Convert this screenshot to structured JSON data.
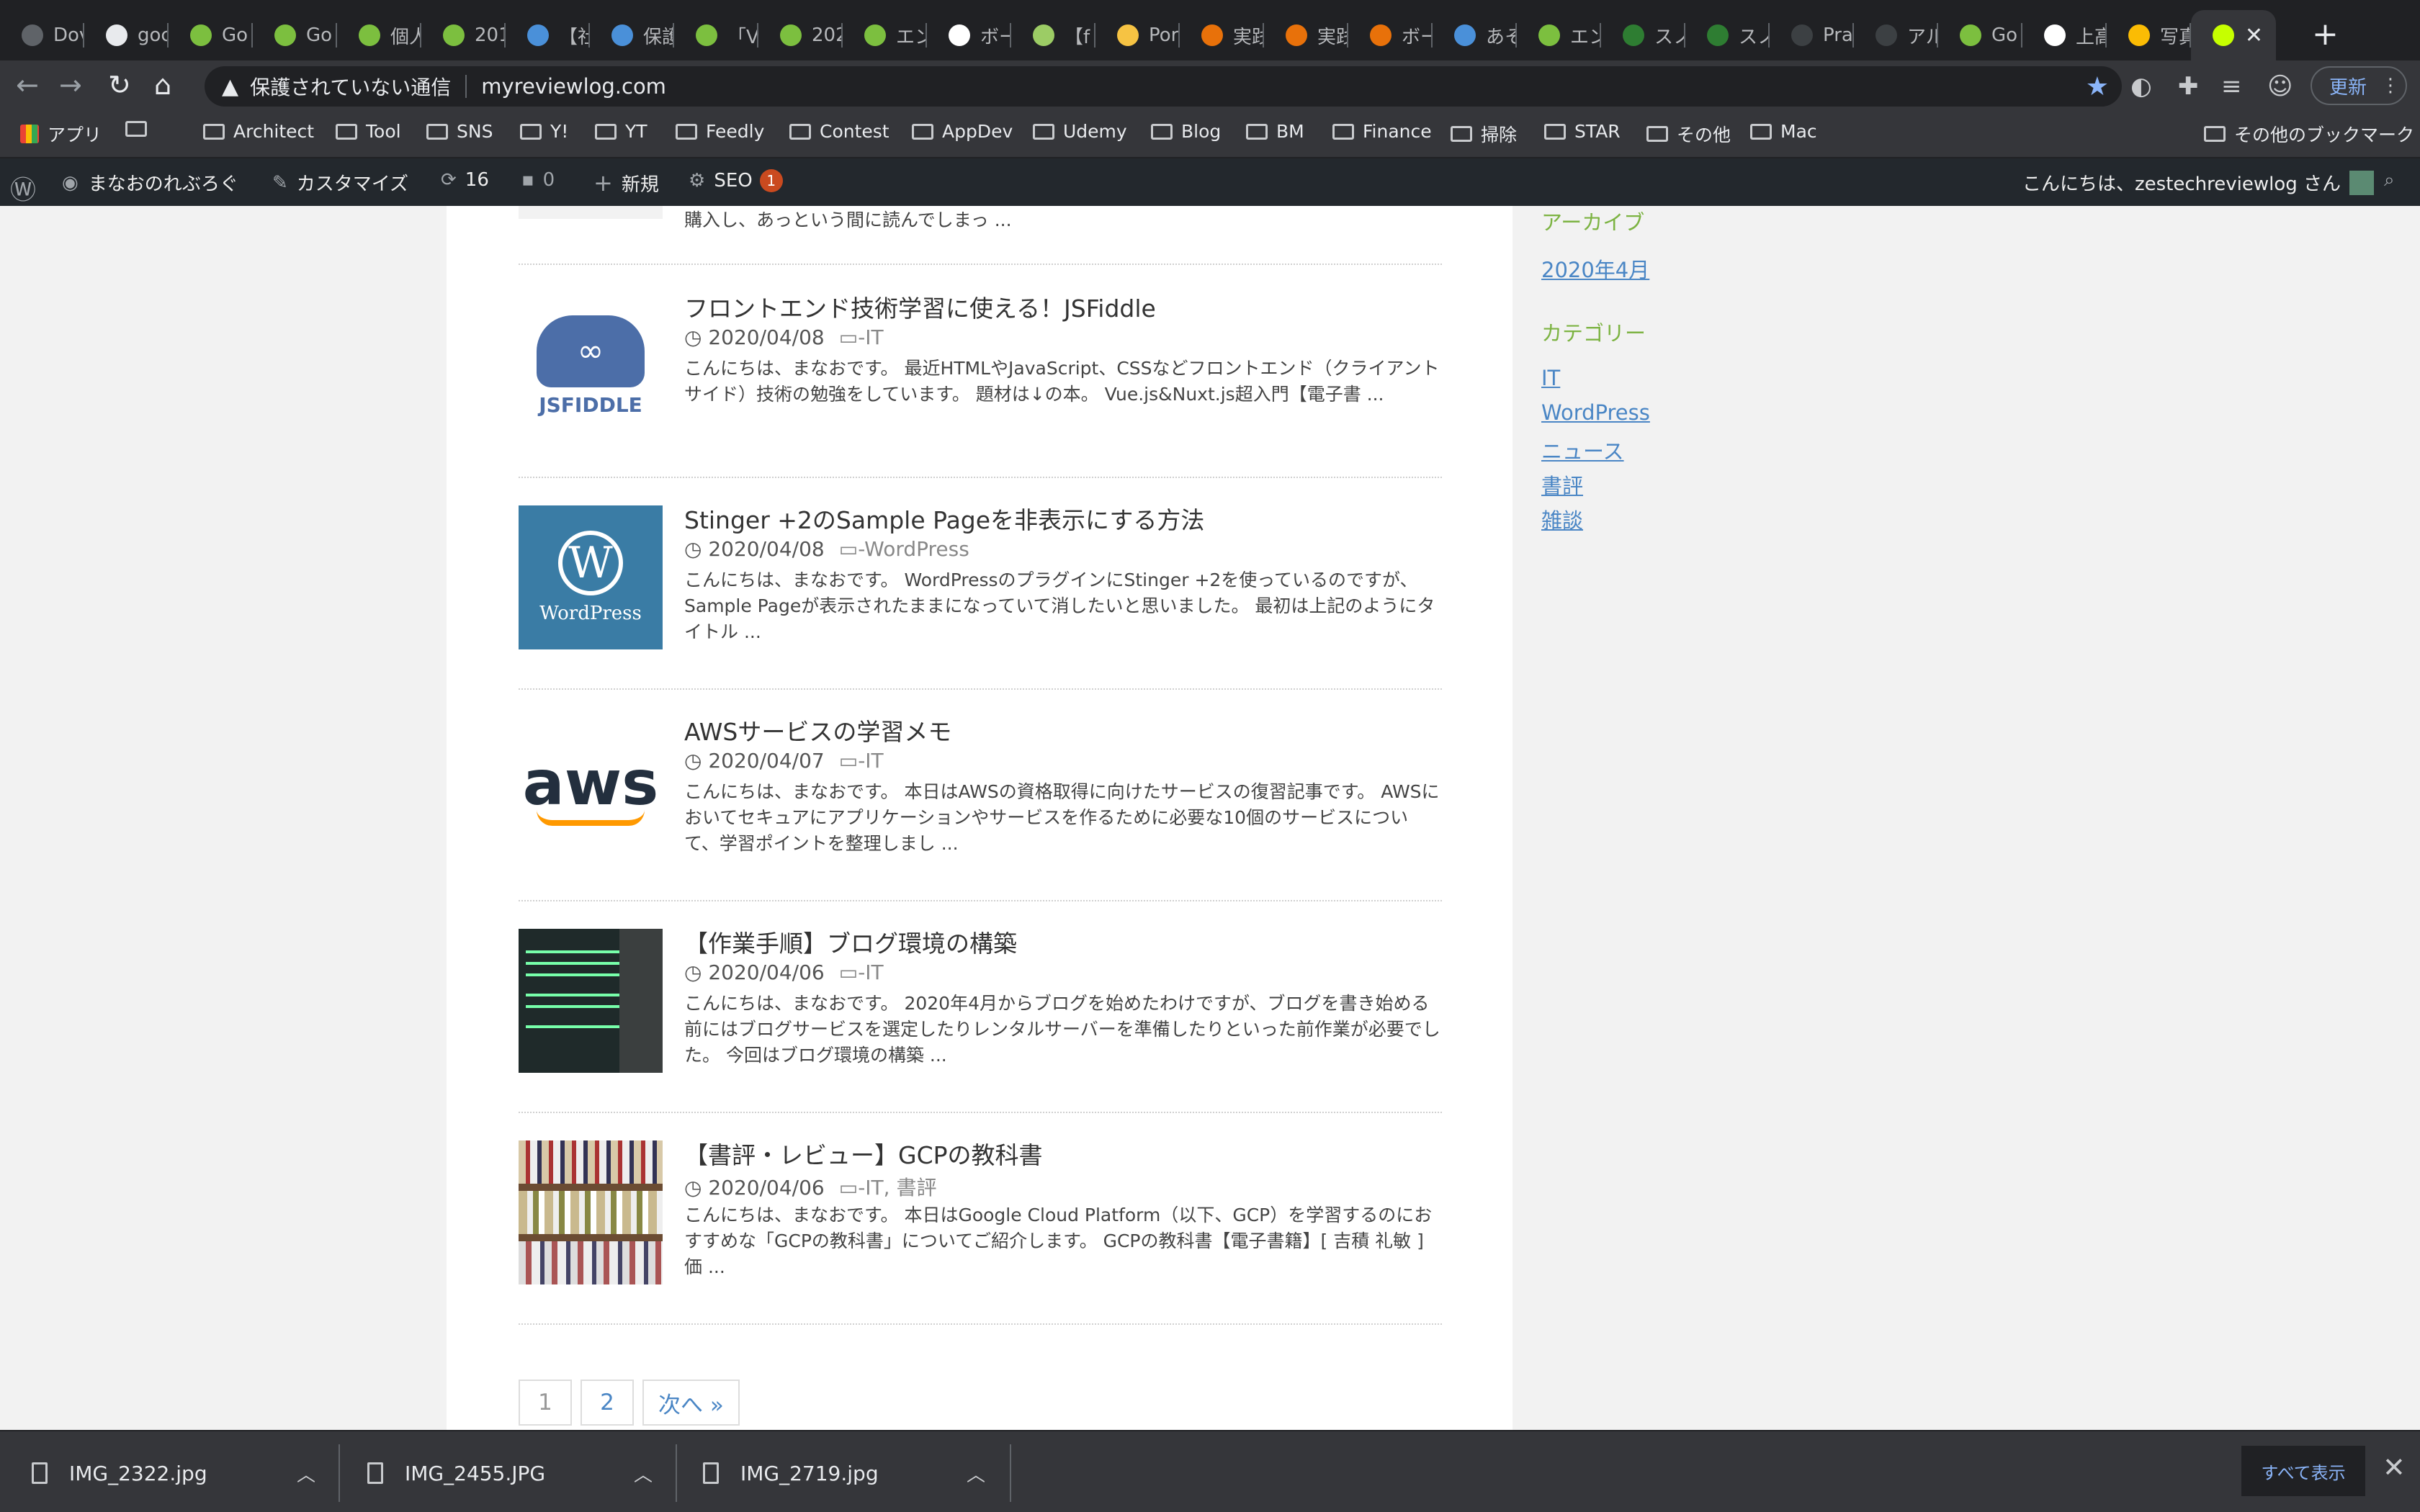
{
  "tabs": [
    {
      "label": "Dov",
      "color": "#5f6368"
    },
    {
      "label": "goc",
      "color": "#e8eaed"
    },
    {
      "label": "Go",
      "color": "#7cbf3f"
    },
    {
      "label": "Go",
      "color": "#7cbf3f"
    },
    {
      "label": "個人",
      "color": "#7cbf3f"
    },
    {
      "label": "201",
      "color": "#7cbf3f"
    },
    {
      "label": "【社",
      "color": "#4a90d9"
    },
    {
      "label": "保護",
      "color": "#4a90d9"
    },
    {
      "label": "「V",
      "color": "#7cbf3f"
    },
    {
      "label": "202",
      "color": "#7cbf3f"
    },
    {
      "label": "エン",
      "color": "#7cbf3f"
    },
    {
      "label": "ボー",
      "color": "#ffffff"
    },
    {
      "label": "【f",
      "color": "#9ccc65"
    },
    {
      "label": "Por",
      "color": "#f6c343"
    },
    {
      "label": "実践",
      "color": "#e8710a"
    },
    {
      "label": "実践",
      "color": "#e8710a"
    },
    {
      "label": "ボー",
      "color": "#e8710a"
    },
    {
      "label": "あそ",
      "color": "#4a90d9"
    },
    {
      "label": "エン",
      "color": "#7cbf3f"
    },
    {
      "label": "スノ",
      "color": "#2e7d32"
    },
    {
      "label": "スノ",
      "color": "#2e7d32"
    },
    {
      "label": "Pra",
      "color": "#3c4043"
    },
    {
      "label": "アル",
      "color": "#3c4043"
    },
    {
      "label": "Go",
      "color": "#7cbf3f"
    },
    {
      "label": "上高",
      "color": "#ffffff"
    },
    {
      "label": "写真",
      "color": "#fbbc04"
    },
    {
      "label": "",
      "color": "#c6ff00"
    }
  ],
  "address": {
    "security": "保護されていない通信",
    "url": "myreviewlog.com",
    "update": "更新"
  },
  "bookmarks": [
    {
      "label": "アプリ"
    },
    {
      "label": ""
    },
    {
      "label": "Architect"
    },
    {
      "label": "Tool"
    },
    {
      "label": "SNS"
    },
    {
      "label": "Y!"
    },
    {
      "label": "YT"
    },
    {
      "label": "Feedly"
    },
    {
      "label": "Contest"
    },
    {
      "label": "AppDev"
    },
    {
      "label": "Udemy"
    },
    {
      "label": "Blog"
    },
    {
      "label": "BM"
    },
    {
      "label": "Finance"
    },
    {
      "label": "掃除"
    },
    {
      "label": "STAR"
    },
    {
      "label": "その他"
    },
    {
      "label": "Mac"
    },
    {
      "label": "その他のブックマーク"
    }
  ],
  "wp": {
    "site": "まなおのれぶろぐ",
    "customize": "カスタマイズ",
    "updates": "16",
    "comments": "0",
    "new": "新規",
    "seo": "SEO",
    "seo_badge": "1",
    "greeting": "こんにちは、zestechreviewlog さん"
  },
  "top_excerpt": "購入し、あっという間に読んでしまっ ...",
  "posts": [
    {
      "title": "フロントエンド技術学習に使える！JSFiddle",
      "date": "2020/04/08",
      "cat": "IT",
      "excerpt": "こんにちは、まなおです。 最近HTMLやJavaScript、CSSなどフロントエンド（クライアントサイド）技術の勉強をしています。 題材は↓の本。 Vue.js&Nuxt.js超入門【電子書 ...",
      "thumb": "JSFIDDLE"
    },
    {
      "title": "Stinger +2のSample Pageを非表示にする方法",
      "date": "2020/04/08",
      "cat": "WordPress",
      "excerpt": "こんにちは、まなおです。 WordPressのプラグインにStinger +2を使っているのですが、Sample Pageが表示されたままになっていて消したいと思いました。 最初は上記のようにタイトル ...",
      "thumb": "WordPress"
    },
    {
      "title": "AWSサービスの学習メモ",
      "date": "2020/04/07",
      "cat": "IT",
      "excerpt": "こんにちは、まなおです。 本日はAWSの資格取得に向けたサービスの復習記事です。 AWSにおいてセキュアにアプリケーションやサービスを作るために必要な10個のサービスについて、学習ポイントを整理しまし ...",
      "thumb": "aws"
    },
    {
      "title": "【作業手順】ブログ環境の構築",
      "date": "2020/04/06",
      "cat": "IT",
      "excerpt": "こんにちは、まなおです。 2020年4月からブログを始めたわけですが、ブログを書き始める前にはブログサービスを選定したりレンタルサーバーを準備したりといった前作業が必要でした。 今回はブログ環境の構築 ...",
      "thumb": ""
    },
    {
      "title": "【書評・レビュー】GCPの教科書",
      "date": "2020/04/06",
      "cat": "IT, 書評",
      "excerpt": "こんにちは、まなおです。 本日はGoogle Cloud Platform（以下、GCP）を学習するのにおすすめな「GCPの教科書」についてご紹介します。 GCPの教科書【電子書籍】[ 吉積 礼敏 ]価 ...",
      "thumb": ""
    }
  ],
  "pager": {
    "p1": "1",
    "p2": "2",
    "next": "次へ »"
  },
  "sidebar": {
    "archive_heading": "アーカイブ",
    "archive_item": "2020年4月",
    "category_heading": "カテゴリー",
    "categories": [
      "IT",
      "WordPress",
      "ニュース",
      "書評",
      "雑談"
    ]
  },
  "downloads": [
    {
      "name": "IMG_2322.jpg"
    },
    {
      "name": "IMG_2455.JPG"
    },
    {
      "name": "IMG_2719.jpg"
    }
  ],
  "show_all": "すべて表示"
}
